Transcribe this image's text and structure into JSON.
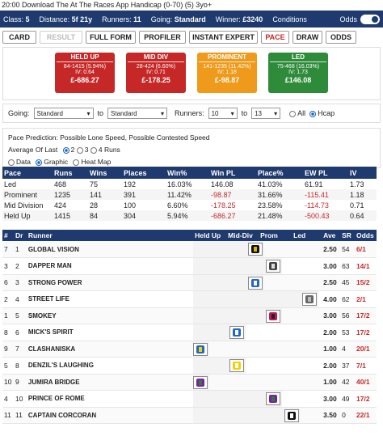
{
  "page_title": "20:00 Download The At The Races App Handicap (0-70) (5) 3yo+",
  "info": {
    "class_label": "Class:",
    "class_value": "5",
    "distance_label": "Distance:",
    "distance_value": "5f 21y",
    "runners_label": "Runners:",
    "runners_value": "11",
    "going_label": "Going:",
    "going_value": "Standard",
    "winner_label": "Winner:",
    "winner_value": "£3240",
    "conditions_label": "Conditions",
    "odds_label": "Odds"
  },
  "tabs": [
    "CARD",
    "RESULT",
    "FULL FORM",
    "PROFILER",
    "INSTANT EXPERT",
    "PACE",
    "DRAW",
    "ODDS"
  ],
  "pace_boxes": [
    {
      "title": "HELD UP",
      "runs": "84-1415 (5.94%)",
      "iv": "IV: 0.64",
      "pl": "£-686.27",
      "color": "red"
    },
    {
      "title": "MID DIV",
      "runs": "28-424 (6.60%)",
      "iv": "IV: 0.71",
      "pl": "£-178.25",
      "color": "red"
    },
    {
      "title": "PROMINENT",
      "runs": "141-1235 (11.42%)",
      "iv": "IV: 1.18",
      "pl": "£-98.87",
      "color": "orange"
    },
    {
      "title": "LED",
      "runs": "75-468 (16.03%)",
      "iv": "IV: 1.73",
      "pl": "£146.08",
      "color": "green"
    }
  ],
  "filters": {
    "going_label": "Going:",
    "going_from": "Standard",
    "to_label": "to",
    "going_to": "Standard",
    "runners_label": "Runners:",
    "runners_from": "10",
    "runners_to": "13",
    "all_label": "All",
    "hcap_label": "Hcap"
  },
  "prediction": {
    "text": "Pace Prediction: Possible Lone Speed, Possible Contested Speed",
    "average_label": "Average Of Last",
    "avg_options": [
      "2",
      "3",
      "4 Runs"
    ],
    "view_options": [
      "Data",
      "Graphic",
      "Heat Map"
    ]
  },
  "stats": {
    "headers": [
      "Pace",
      "Runs",
      "Wins",
      "Places",
      "Win%",
      "Win PL",
      "Place%",
      "EW PL",
      "IV"
    ],
    "rows": [
      [
        "Led",
        "468",
        "75",
        "192",
        "16.03%",
        "146.08",
        "41.03%",
        "61.91",
        "1.73"
      ],
      [
        "Prominent",
        "1235",
        "141",
        "391",
        "11.42%",
        "-98.87",
        "31.66%",
        "-115.41",
        "1.18"
      ],
      [
        "Mid Division",
        "424",
        "28",
        "100",
        "6.60%",
        "-178.25",
        "23.58%",
        "-114.73",
        "0.71"
      ],
      [
        "Held Up",
        "1415",
        "84",
        "304",
        "5.94%",
        "-686.27",
        "21.48%",
        "-500.43",
        "0.64"
      ]
    ]
  },
  "runners": {
    "headers": [
      "#",
      "Dr",
      "Runner",
      "Held Up",
      "Mid-Div",
      "Prom",
      "Led",
      "Ave",
      "SR",
      "Odds"
    ],
    "rows": [
      {
        "num": "7",
        "draw": "1",
        "name": "GLOBAL VISION",
        "pos": 2.5,
        "ave": "2.50",
        "sr": "54",
        "odds": "6/1"
      },
      {
        "num": "3",
        "draw": "2",
        "name": "DAPPER MAN",
        "pos": 3.0,
        "ave": "3.00",
        "sr": "63",
        "odds": "14/1"
      },
      {
        "num": "6",
        "draw": "3",
        "name": "STRONG POWER",
        "pos": 2.5,
        "ave": "2.50",
        "sr": "45",
        "odds": "15/2"
      },
      {
        "num": "2",
        "draw": "4",
        "name": "STREET LIFE",
        "pos": 4.0,
        "ave": "4.00",
        "sr": "62",
        "odds": "2/1"
      },
      {
        "num": "1",
        "draw": "5",
        "name": "SMOKEY",
        "pos": 3.0,
        "ave": "3.00",
        "sr": "56",
        "odds": "17/2"
      },
      {
        "num": "8",
        "draw": "6",
        "name": "MICK'S SPIRIT",
        "pos": 2.0,
        "ave": "2.00",
        "sr": "53",
        "odds": "17/2"
      },
      {
        "num": "9",
        "draw": "7",
        "name": "CLASHANISKA",
        "pos": 1.0,
        "ave": "1.00",
        "sr": "4",
        "odds": "20/1"
      },
      {
        "num": "5",
        "draw": "8",
        "name": "DENZIL'S LAUGHING",
        "pos": 2.0,
        "ave": "2.00",
        "sr": "37",
        "odds": "7/1"
      },
      {
        "num": "10",
        "draw": "9",
        "name": "JUMIRA BRIDGE",
        "pos": 1.0,
        "ave": "1.00",
        "sr": "42",
        "odds": "40/1"
      },
      {
        "num": "4",
        "draw": "10",
        "name": "PRINCE OF ROME",
        "pos": 3.0,
        "ave": "3.00",
        "sr": "49",
        "odds": "17/2"
      },
      {
        "num": "11",
        "draw": "11",
        "name": "CAPTAIN CORCORAN",
        "pos": 3.5,
        "ave": "3.50",
        "sr": "0",
        "odds": "22/1"
      }
    ]
  }
}
